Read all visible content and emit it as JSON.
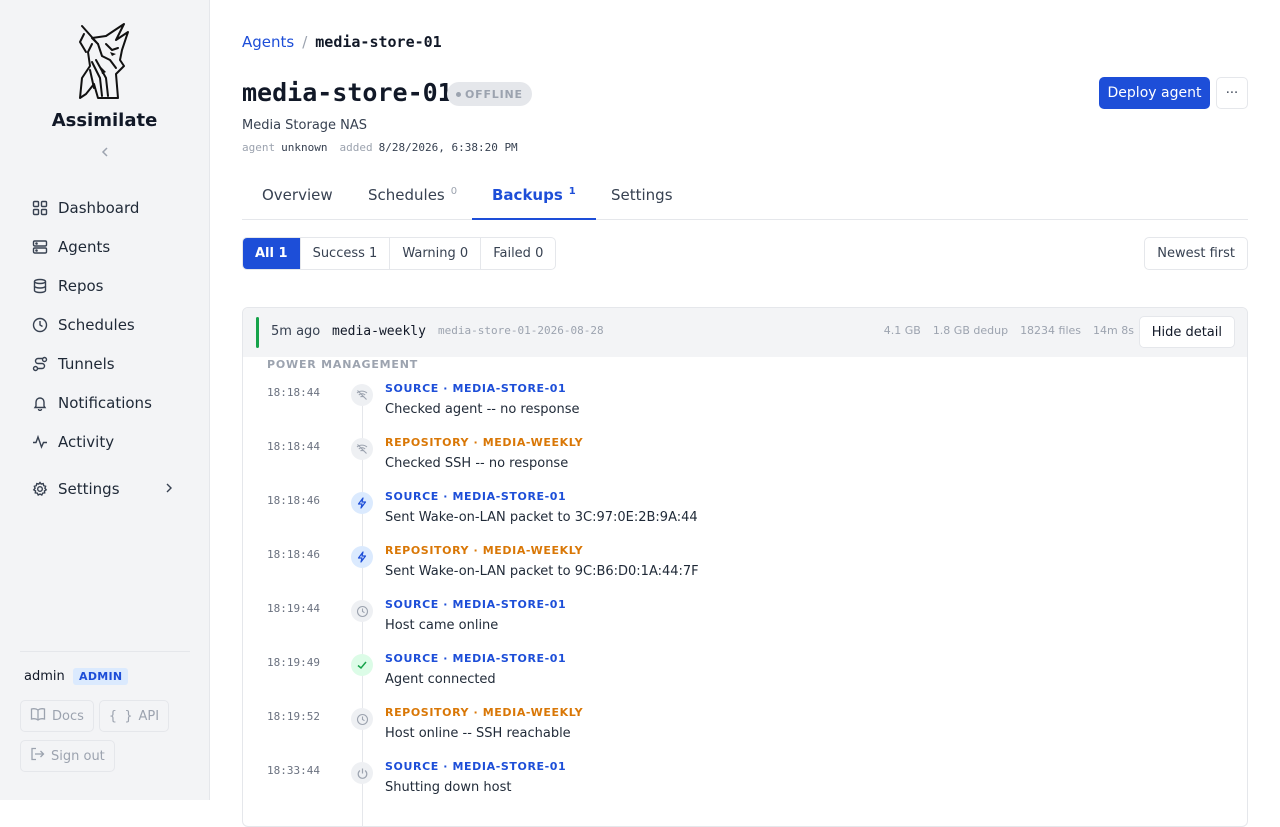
{
  "sidebar": {
    "brand": "Assimilate",
    "collapse_icon": "chevron-left-icon",
    "items": [
      {
        "label": "Dashboard",
        "icon": "grid-icon"
      },
      {
        "label": "Agents",
        "icon": "server-icon"
      },
      {
        "label": "Repos",
        "icon": "database-icon"
      },
      {
        "label": "Schedules",
        "icon": "clock-icon"
      },
      {
        "label": "Tunnels",
        "icon": "route-icon"
      },
      {
        "label": "Notifications",
        "icon": "bell-icon"
      },
      {
        "label": "Activity",
        "icon": "pulse-icon"
      },
      {
        "label": "Settings",
        "icon": "gear-icon"
      }
    ],
    "user": {
      "name": "admin",
      "role": "ADMIN"
    },
    "docs_label": "Docs",
    "api_label": "API",
    "signout_label": "Sign out"
  },
  "breadcrumb": {
    "parent": "Agents",
    "separator": "/",
    "current": "media-store-01"
  },
  "header": {
    "title": "media-store-01",
    "status": "OFFLINE",
    "subtitle": "Media Storage NAS",
    "meta": {
      "agent_key": "agent",
      "agent_value": "unknown",
      "added_key": "added",
      "added_value": "8/28/2026, 6:38:20 PM"
    },
    "deploy_label": "Deploy agent",
    "more_label": "···"
  },
  "tabs": [
    {
      "label": "Overview",
      "count": ""
    },
    {
      "label": "Schedules",
      "count": "0"
    },
    {
      "label": "Backups",
      "count": "1",
      "active": true
    },
    {
      "label": "Settings",
      "count": ""
    }
  ],
  "filters": [
    {
      "label": "All",
      "count": "1",
      "active": true
    },
    {
      "label": "Success",
      "count": "1"
    },
    {
      "label": "Warning",
      "count": "0"
    },
    {
      "label": "Failed",
      "count": "0"
    }
  ],
  "sort_label": "Newest first",
  "backup": {
    "ago": "5m ago",
    "schedule": "media-weekly",
    "archive": "media-store-01-2026-08-28",
    "size": "4.1 GB",
    "dedup": "1.8 GB dedup",
    "files": "18234 files",
    "duration": "14m 8s",
    "hide_label": "Hide detail",
    "status_color": "#16a34a",
    "section": "POWER MANAGEMENT",
    "events": [
      {
        "time": "18:18:44",
        "icon": "no-signal-icon",
        "source": "SOURCE · MEDIA-STORE-01",
        "kind": "source",
        "message": "Checked agent -- no response"
      },
      {
        "time": "18:18:44",
        "icon": "no-signal-icon",
        "source": "REPOSITORY · MEDIA-WEEKLY",
        "kind": "repo",
        "message": "Checked SSH -- no response"
      },
      {
        "time": "18:18:46",
        "icon": "bolt-icon",
        "source": "SOURCE · MEDIA-STORE-01",
        "kind": "source",
        "message": "Sent Wake-on-LAN packet to 3C:97:0E:2B:9A:44"
      },
      {
        "time": "18:18:46",
        "icon": "bolt-icon",
        "source": "REPOSITORY · MEDIA-WEEKLY",
        "kind": "repo",
        "message": "Sent Wake-on-LAN packet to 9C:B6:D0:1A:44:7F"
      },
      {
        "time": "18:19:44",
        "icon": "clock-icon",
        "source": "SOURCE · MEDIA-STORE-01",
        "kind": "source",
        "message": "Host came online"
      },
      {
        "time": "18:19:49",
        "icon": "check-icon",
        "source": "SOURCE · MEDIA-STORE-01",
        "kind": "source",
        "message": "Agent connected"
      },
      {
        "time": "18:19:52",
        "icon": "clock-icon",
        "source": "REPOSITORY · MEDIA-WEEKLY",
        "kind": "repo",
        "message": "Host online -- SSH reachable"
      },
      {
        "time": "18:33:44",
        "icon": "power-icon",
        "source": "SOURCE · MEDIA-STORE-01",
        "kind": "source",
        "message": "Shutting down host"
      }
    ]
  },
  "colors": {
    "accent": "#1d4ed8",
    "repo": "#d97706",
    "success": "#16a34a"
  }
}
